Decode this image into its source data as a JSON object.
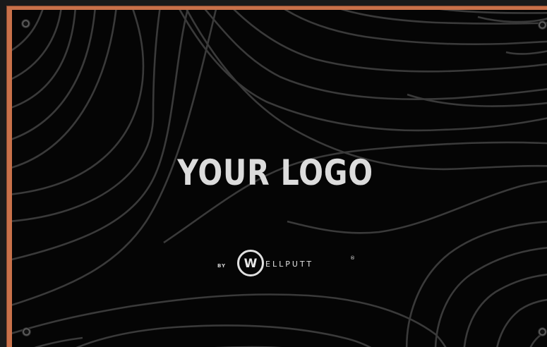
{
  "mat": {
    "title": "YOUR LOGO",
    "brand": {
      "by": "BY",
      "w": "W",
      "name": "ELLPUTT",
      "registered": "®"
    }
  },
  "colors": {
    "border": "#c9714a",
    "mat": "#050505",
    "contour": "#3a3a3a",
    "text": "#dcdcdc"
  },
  "icons": {
    "grommet": "grommet-icon",
    "brand_logo": "wellputt-logo-icon"
  }
}
